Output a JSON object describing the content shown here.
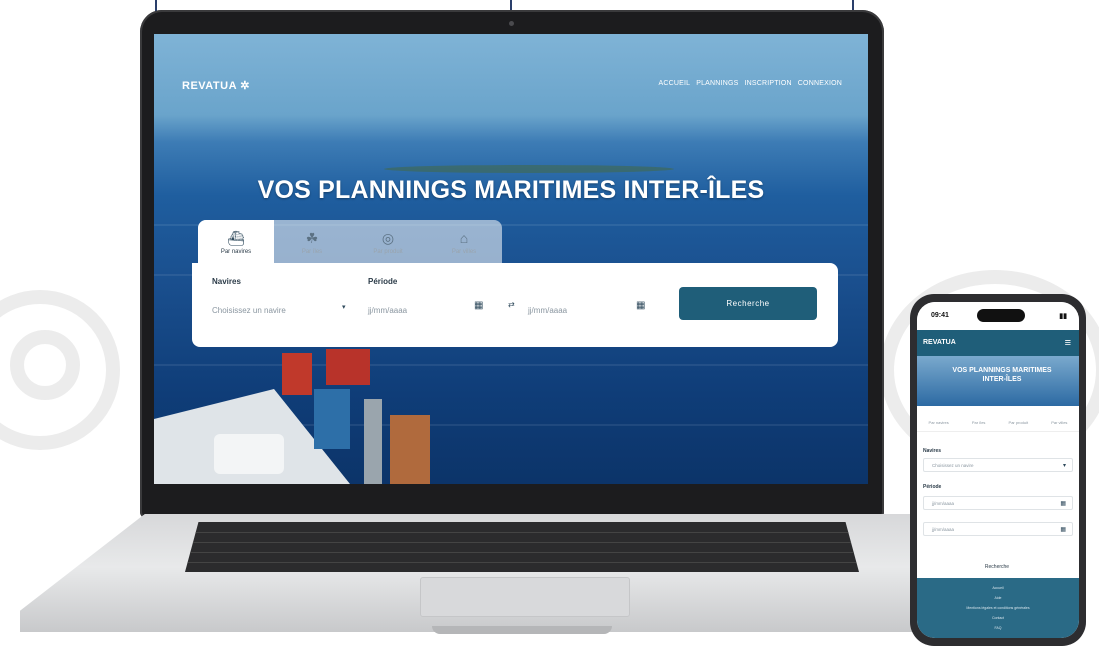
{
  "laptop": {
    "logo": "REVATUA",
    "nav": [
      "ACCUEIL",
      "PLANNINGS",
      "INSCRIPTION",
      "CONNEXION"
    ],
    "hero_title": "VOS PLANNINGS MARITIMES INTER-ÎLES",
    "tabs": [
      {
        "label": "Par navires",
        "icon": "ship-icon",
        "active": true
      },
      {
        "label": "Par îles",
        "icon": "island-icon",
        "active": false
      },
      {
        "label": "Par produit",
        "icon": "box-icon",
        "active": false
      },
      {
        "label": "Par villes",
        "icon": "city-icon",
        "active": false
      }
    ],
    "form": {
      "navires_label": "Navires",
      "navires_placeholder": "Choisissez un navire",
      "periode_label": "Période",
      "date_start_placeholder": "jj/mm/aaaa",
      "date_end_placeholder": "jj/mm/aaaa",
      "search_button": "Recherche"
    }
  },
  "phone": {
    "time": "09:41",
    "logo": "REVATUA",
    "hero_title": "VOS PLANNINGS MARITIMES INTER-ÎLES",
    "tabs": [
      "Par navires",
      "Par îles",
      "Par produit",
      "Par villes"
    ],
    "navires_label": "Navires",
    "navires_placeholder": "Choisissez un navire",
    "periode_label": "Période",
    "date_start_placeholder": "jj/mm/aaaa",
    "date_end_placeholder": "jj/mm/aaaa",
    "search_button": "Recherche",
    "footer_items": [
      "Accueil",
      "Aide",
      "Mentions légales et conditions générales",
      "Contact",
      "FAQ"
    ]
  },
  "colors": {
    "primary": "#1f5e79",
    "ocean": "#1a4f8e",
    "footer": "#2a6a86"
  }
}
